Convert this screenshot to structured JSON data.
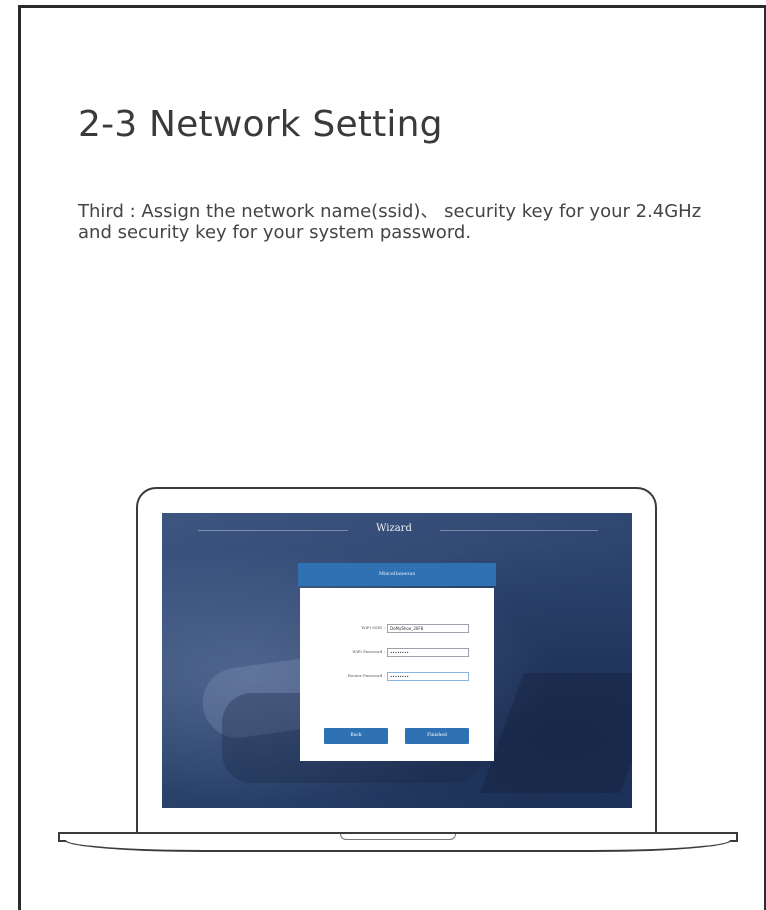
{
  "page": {
    "title": "2-3 Network Setting",
    "description": "Third : Assign the network name(ssid)、 security key for your 2.4GHz and security key for your system password."
  },
  "screen": {
    "wizard_title": "Wizard",
    "dialog_title": "Miscellaneous",
    "fields": [
      {
        "label": "WiFi SSID :",
        "value": "DoMyShoe_26F8"
      },
      {
        "label": "WiFi Password :",
        "value": "••••••••"
      },
      {
        "label": "Router Password :",
        "value": "••••••••"
      }
    ],
    "back_label": "Back",
    "finished_label": "Finished",
    "accent_color": "#2f72b4"
  }
}
